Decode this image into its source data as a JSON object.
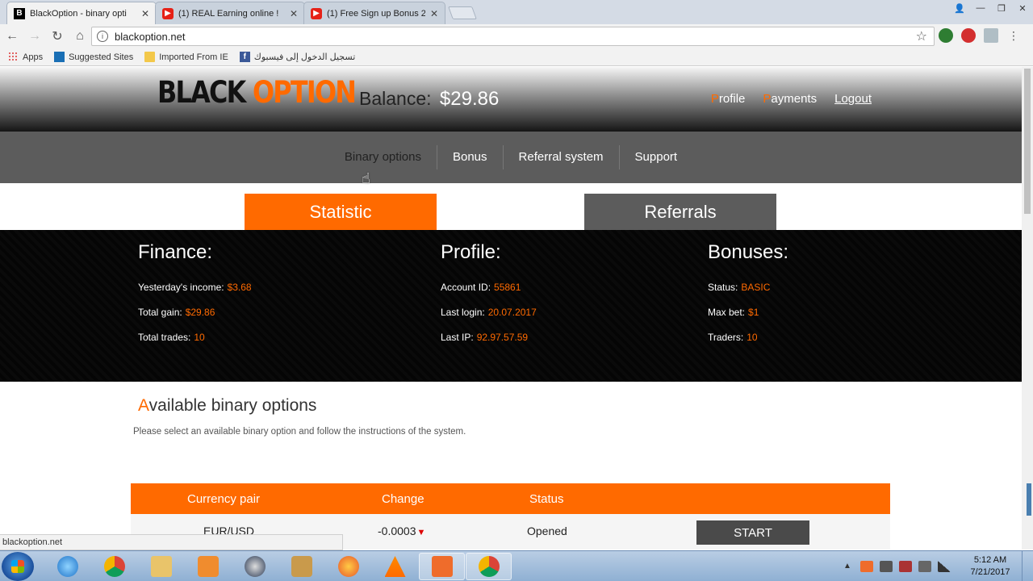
{
  "browser": {
    "tabs": [
      {
        "title": "BlackOption - binary opti",
        "icon": "blackoption-favicon",
        "active": true
      },
      {
        "title": "(1) REAL Earning online !",
        "icon": "youtube-icon",
        "active": false
      },
      {
        "title": "(1) Free Sign up Bonus 2",
        "icon": "youtube-icon",
        "active": false
      }
    ],
    "close_glyph": "✕",
    "url": "blackoption.net",
    "bookmarks": {
      "apps": "Apps",
      "suggested": "Suggested Sites",
      "imported": "Imported From IE",
      "fb": "تسجيل الدخول إلى فيسبوك"
    },
    "status_url": "blackoption.net"
  },
  "site": {
    "logo_part1": "BLACK",
    "logo_part2": "OPTION",
    "balance_label": "Balance:",
    "balance_value": "$29.86",
    "top_links": {
      "profile_first": "P",
      "profile_rest": "rofile",
      "payments_first": "P",
      "payments_rest": "ayments",
      "logout": "Logout"
    },
    "nav": [
      "Binary options",
      "Bonus",
      "Referral system",
      "Support"
    ],
    "tabs": {
      "statistic": "Statistic",
      "referrals": "Referrals"
    },
    "finance": {
      "title": "Finance:",
      "rows": [
        {
          "label": "Yesterday's income:",
          "value": "$3.68"
        },
        {
          "label": "Total gain:",
          "value": "$29.86"
        },
        {
          "label": "Total trades:",
          "value": "10"
        }
      ]
    },
    "profile": {
      "title": "Profile:",
      "rows": [
        {
          "label": "Account ID:",
          "value": "55861"
        },
        {
          "label": "Last login:",
          "value": "20.07.2017"
        },
        {
          "label": "Last IP:",
          "value": "92.97.57.59"
        }
      ]
    },
    "bonuses": {
      "title": "Bonuses:",
      "rows": [
        {
          "label": "Status:",
          "value": "BASIC"
        },
        {
          "label": "Max bet:",
          "value": "$1"
        },
        {
          "label": "Traders:",
          "value": "10"
        }
      ]
    },
    "available": {
      "title_first": "A",
      "title_rest": "vailable binary options",
      "description": "Please select an available binary option and follow the instructions of the system."
    },
    "table": {
      "headers": [
        "Currency pair",
        "Change",
        "Status"
      ],
      "rows": [
        {
          "pair": "EUR/USD",
          "change": "-0.0003",
          "arrow": "▼",
          "status": "Opened",
          "action": "START"
        }
      ]
    }
  },
  "taskbar": {
    "time": "5:12 AM",
    "date": "7/21/2017"
  }
}
